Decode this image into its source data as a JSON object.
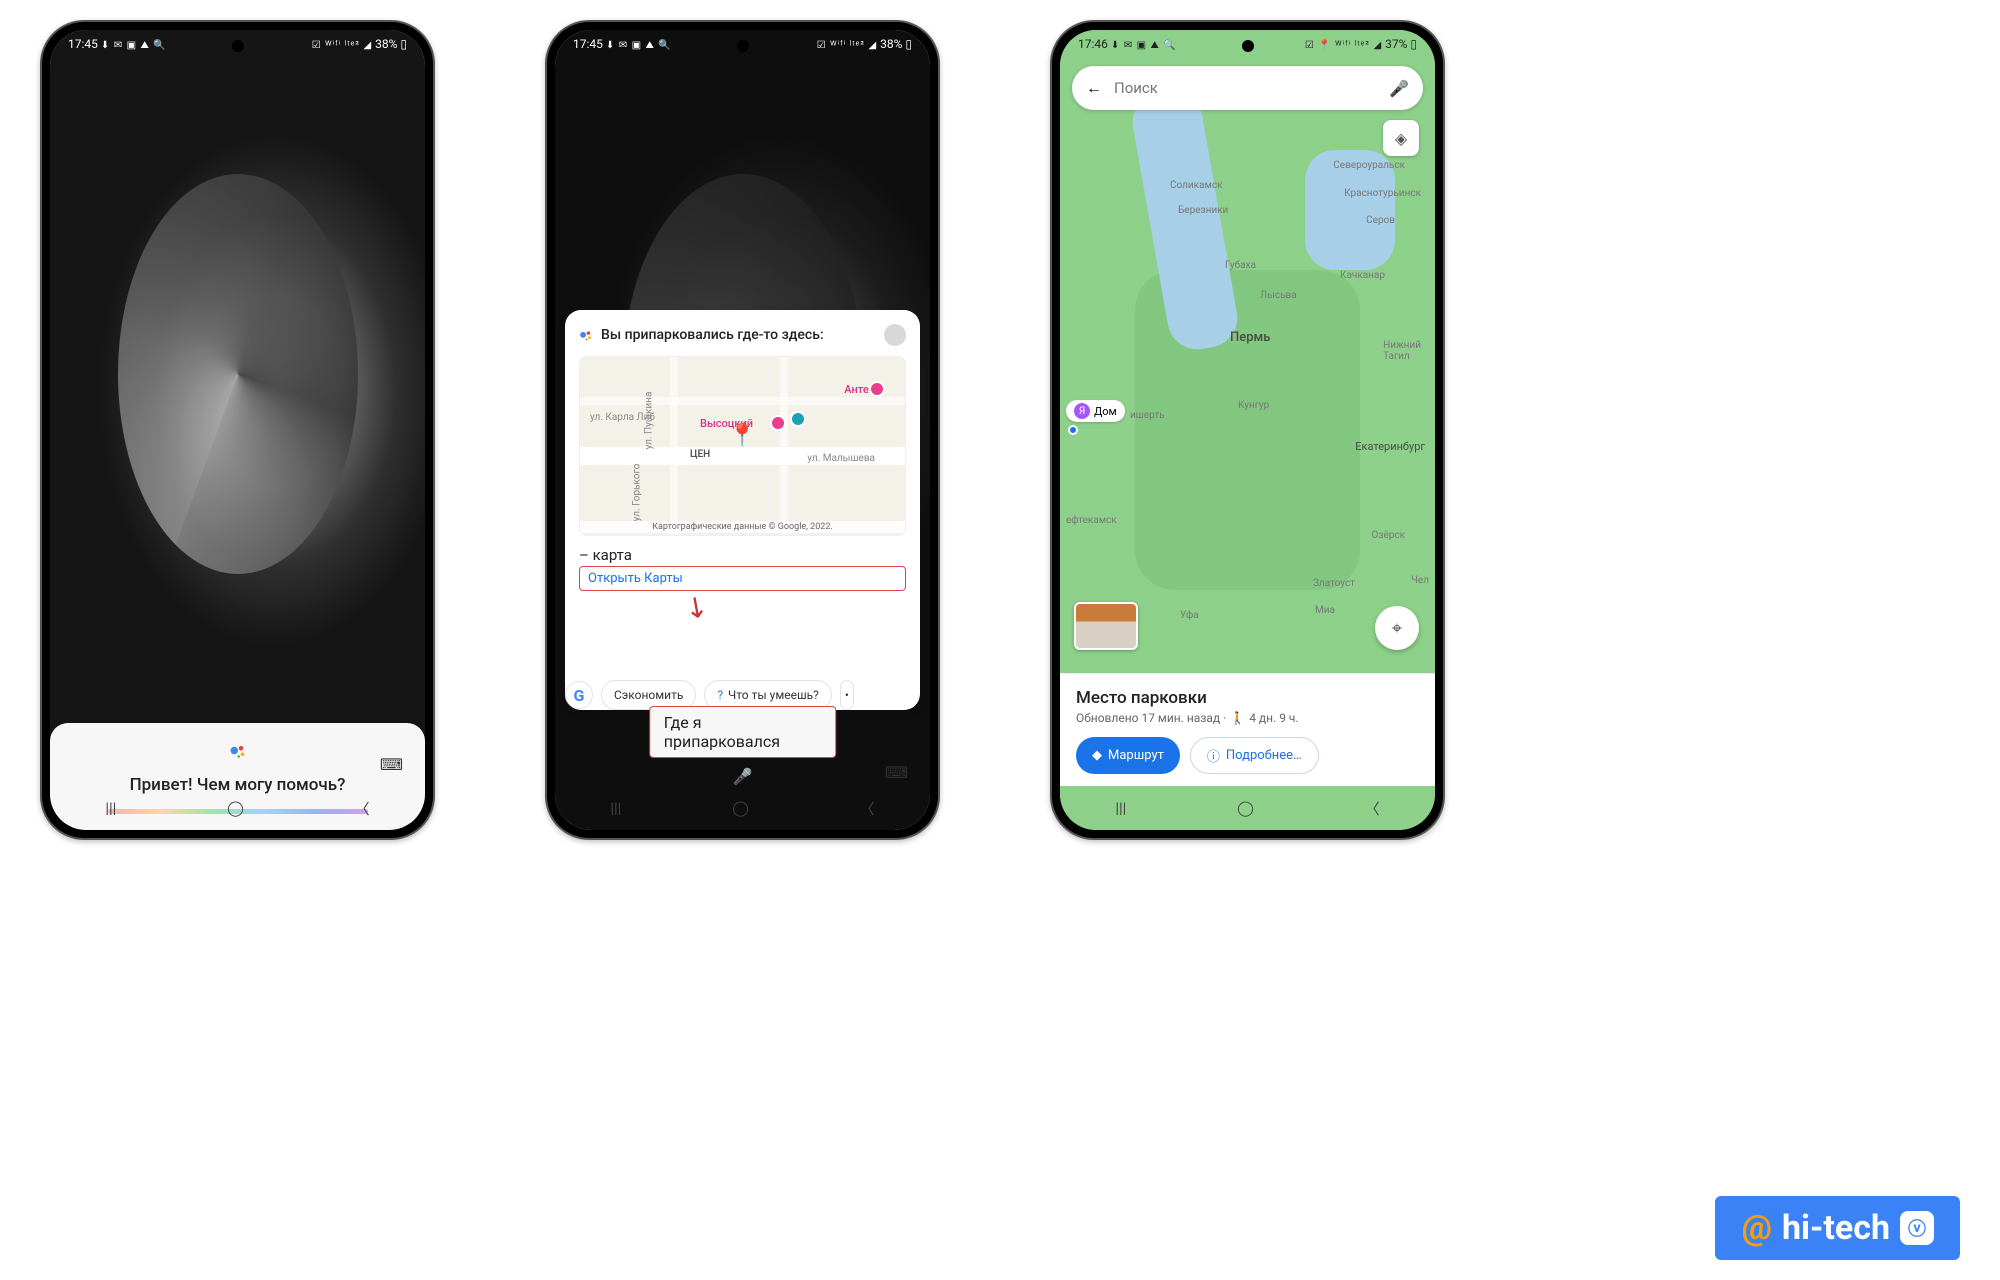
{
  "phone1": {
    "status": {
      "time": "17:45",
      "battery": "38%",
      "icons": "⬇ ✉ ▣ ⛰ 🔍",
      "right": "☑ ᵂⁱᶠⁱ ˡᵗᵉ² ◢"
    },
    "greeting": "Привет! Чем могу помочь?"
  },
  "phone2": {
    "status": {
      "time": "17:45",
      "battery": "38%"
    },
    "cardTitle": "Вы припарковались где-то здесь:",
    "map": {
      "poi1": "Высоцкий",
      "poi2": "Антей",
      "street1": "ул. Пушкина",
      "street2": "ул. Малышева",
      "street3": "ул. Горького",
      "street4": "ул. Карла Либ",
      "center": "ЦЕН",
      "attribution": "Картографические данные © Google, 2022."
    },
    "mapName": "– карта",
    "openMaps": "Открыть Карты",
    "chips": {
      "g": "G",
      "save": "Сэкономить",
      "help": "Что ты умеешь?"
    },
    "query": "Где я припарковался"
  },
  "phone3": {
    "status": {
      "time": "17:46",
      "battery": "37%"
    },
    "search": {
      "placeholder": "Поиск"
    },
    "cities": {
      "perm": "Пермь",
      "solikamsk": "Соликамск",
      "berezniki": "Березники",
      "gubakha": "Губаха",
      "kungur": "Кунгур",
      "ekat": "Екатеринбург",
      "ufa": "Уфа",
      "chelyab": "Чел",
      "nizhniyTagil": "Нижний\nТагил",
      "severouralsk": "Североуральск",
      "krasnoturinsk": "Краснотурьинск",
      "serov": "Серов",
      "kachkanar": "Качканар",
      "neftekamsk": "ефтекамск",
      "ozersk": "Озёрск",
      "zlatoust": "Златоуст",
      "miass": "Миа",
      "lysva": "Лысьва",
      "kishert": "ишерть"
    },
    "home": {
      "label": "Дом",
      "initial": "Я"
    },
    "sheet": {
      "title": "Место парковки",
      "subPrefix": "Обновлено 17 мин. назад ·",
      "walkIcon": "🚶",
      "walkTime": "4 дн. 9 ч.",
      "route": "Маршрут",
      "more": "Подробнее…"
    }
  },
  "nav": {
    "recents": "|||",
    "home": "◯",
    "back": "〈"
  },
  "watermark": {
    "at": "@",
    "text": "hi-tech",
    "badge": "ⓥ"
  }
}
